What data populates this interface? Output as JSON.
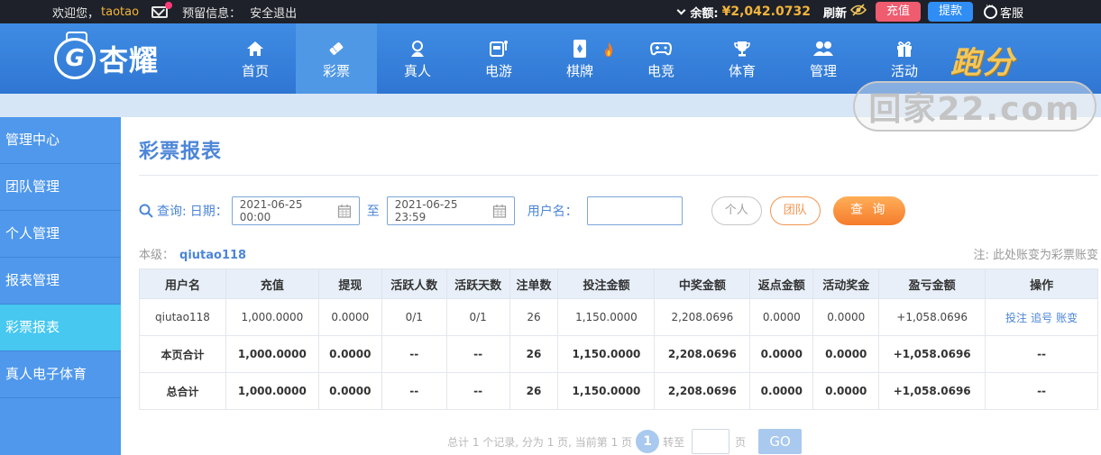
{
  "topbar": {
    "welcome": "欢迎您，",
    "username": "taotao",
    "reserved_label": "预留信息：",
    "logout": "安全退出",
    "balance_label": "余额:",
    "balance_value": "¥2,042.0732",
    "refresh": "刷新",
    "deposit": "充值",
    "withdraw": "提款",
    "service": "客服"
  },
  "header": {
    "logo_letter": "G",
    "logo_text": "杏耀",
    "nav": [
      {
        "label": "首页",
        "icon": "home-icon"
      },
      {
        "label": "彩票",
        "icon": "ticket-icon"
      },
      {
        "label": "真人",
        "icon": "dealer-icon"
      },
      {
        "label": "电游",
        "icon": "slot-icon"
      },
      {
        "label": "棋牌",
        "icon": "cards-icon"
      },
      {
        "label": "电竞",
        "icon": "gamepad-icon"
      },
      {
        "label": "体育",
        "icon": "trophy-icon"
      },
      {
        "label": "管理",
        "icon": "users-icon"
      },
      {
        "label": "活动",
        "icon": "gift-icon"
      }
    ],
    "promo": "跑分"
  },
  "watermark": "回家22.com",
  "sidebar": {
    "items": [
      {
        "label": "管理中心"
      },
      {
        "label": "团队管理"
      },
      {
        "label": "个人管理"
      },
      {
        "label": "报表管理"
      },
      {
        "label": "彩票报表"
      },
      {
        "label": "真人电子体育"
      }
    ]
  },
  "main": {
    "title": "彩票报表",
    "filter": {
      "query_label": "查询:",
      "date_label": "日期：",
      "start_date": "2021-06-25 00:00",
      "to_label": "至",
      "end_date": "2021-06-25 23:59",
      "username_label": "用户名：",
      "username_value": "",
      "personal_button": "个人",
      "team_button": "团队",
      "query_button": "查 询"
    },
    "level_label": "本级：",
    "level_user": "qiutao118",
    "note": "注: 此处账变为彩票账变",
    "table": {
      "columns": [
        "用户名",
        "充值",
        "提现",
        "活跃人数",
        "活跃天数",
        "注单数",
        "投注金额",
        "中奖金额",
        "返点金额",
        "活动奖金",
        "盈亏金额",
        "操作"
      ],
      "rows": [
        [
          "qiutao118",
          "1,000.0000",
          "0.0000",
          "0/1",
          "0/1",
          "26",
          "1,150.0000",
          "2,208.0696",
          "0.0000",
          "0.0000",
          "+1,058.0696",
          ""
        ],
        [
          "本页合计",
          "1,000.0000",
          "0.0000",
          "--",
          "--",
          "26",
          "1,150.0000",
          "2,208.0696",
          "0.0000",
          "0.0000",
          "+1,058.0696",
          "--"
        ],
        [
          "总合计",
          "1,000.0000",
          "0.0000",
          "--",
          "--",
          "26",
          "1,150.0000",
          "2,208.0696",
          "0.0000",
          "0.0000",
          "+1,058.0696",
          "--"
        ]
      ],
      "row_actions": [
        "投注",
        "追号",
        "账变"
      ]
    },
    "pager": {
      "summary": "总计 1 个记录, 分为 1 页, 当前第 1 页",
      "current_page": "1",
      "goto_label": "转至",
      "page_unit": "页",
      "go_button": "GO"
    }
  },
  "colors": {
    "header_blue": "#3f8ce4",
    "accent_orange": "#f57c2c",
    "balance_gold": "#f3b43c",
    "profit_green": "#2a9a2a",
    "sidebar_active": "#46c8f0"
  }
}
